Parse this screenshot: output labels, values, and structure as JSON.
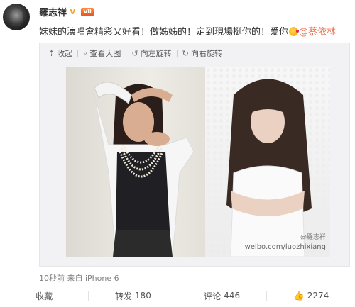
{
  "user": {
    "name": "羅志祥"
  },
  "post": {
    "text_main": "妹妹的演唱會精彩又好看！做姊姊的！定到現場挺你的！爱你",
    "mention": "@蔡依林"
  },
  "toolbar": {
    "collapse": "收起",
    "view_large": "查看大图",
    "rotate_left": "向左旋转",
    "rotate_right": "向右旋转"
  },
  "photo": {
    "watermark_name": "@羅志祥",
    "watermark_url": "weibo.com/luozhixiang"
  },
  "meta": {
    "time_source": "10秒前 来自 iPhone 6"
  },
  "actions": {
    "collect": "收藏",
    "repost_label": "转发",
    "repost_count": "180",
    "comment_label": "评论",
    "comment_count": "446",
    "like_count": "2274"
  },
  "colors": {
    "mention": "#eb7350",
    "like_icon": "#e2772c",
    "vip_badge": "#e8531c"
  }
}
